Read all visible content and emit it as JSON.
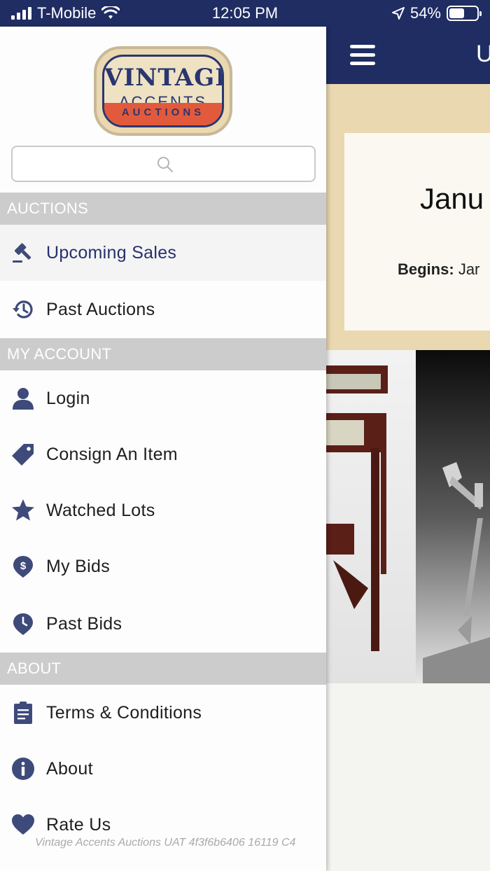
{
  "status_bar": {
    "carrier": "T-Mobile",
    "time": "12:05 PM",
    "battery": "54%",
    "battery_level": 0.54
  },
  "main": {
    "title_peek": "U",
    "sale_title_peek": "Janu",
    "begins_label": "Begins:",
    "begins_value_peek": "Jar"
  },
  "drawer": {
    "logo": {
      "line1": "VINTAGE",
      "line2": "ACCENTS",
      "line3": "AUCTIONS"
    },
    "search": {
      "placeholder": ""
    },
    "sections": {
      "auctions": "AUCTIONS",
      "my_account": "MY ACCOUNT",
      "about": "ABOUT"
    },
    "items": {
      "upcoming_sales": "Upcoming Sales",
      "past_auctions": "Past Auctions",
      "login": "Login",
      "consign": "Consign An Item",
      "watched": "Watched Lots",
      "my_bids": "My Bids",
      "past_bids": "Past Bids",
      "terms": "Terms & Conditions",
      "about": "About",
      "rate_us": "Rate Us"
    },
    "footer": "Vintage Accents Auctions UAT 4f3f6b6406 16119 C4"
  },
  "colors": {
    "navy": "#1f2d63",
    "icon": "#3e4a7a",
    "section_header": "#cccccc",
    "banner": "#ead8b1",
    "logo_red": "#e25a3b"
  }
}
